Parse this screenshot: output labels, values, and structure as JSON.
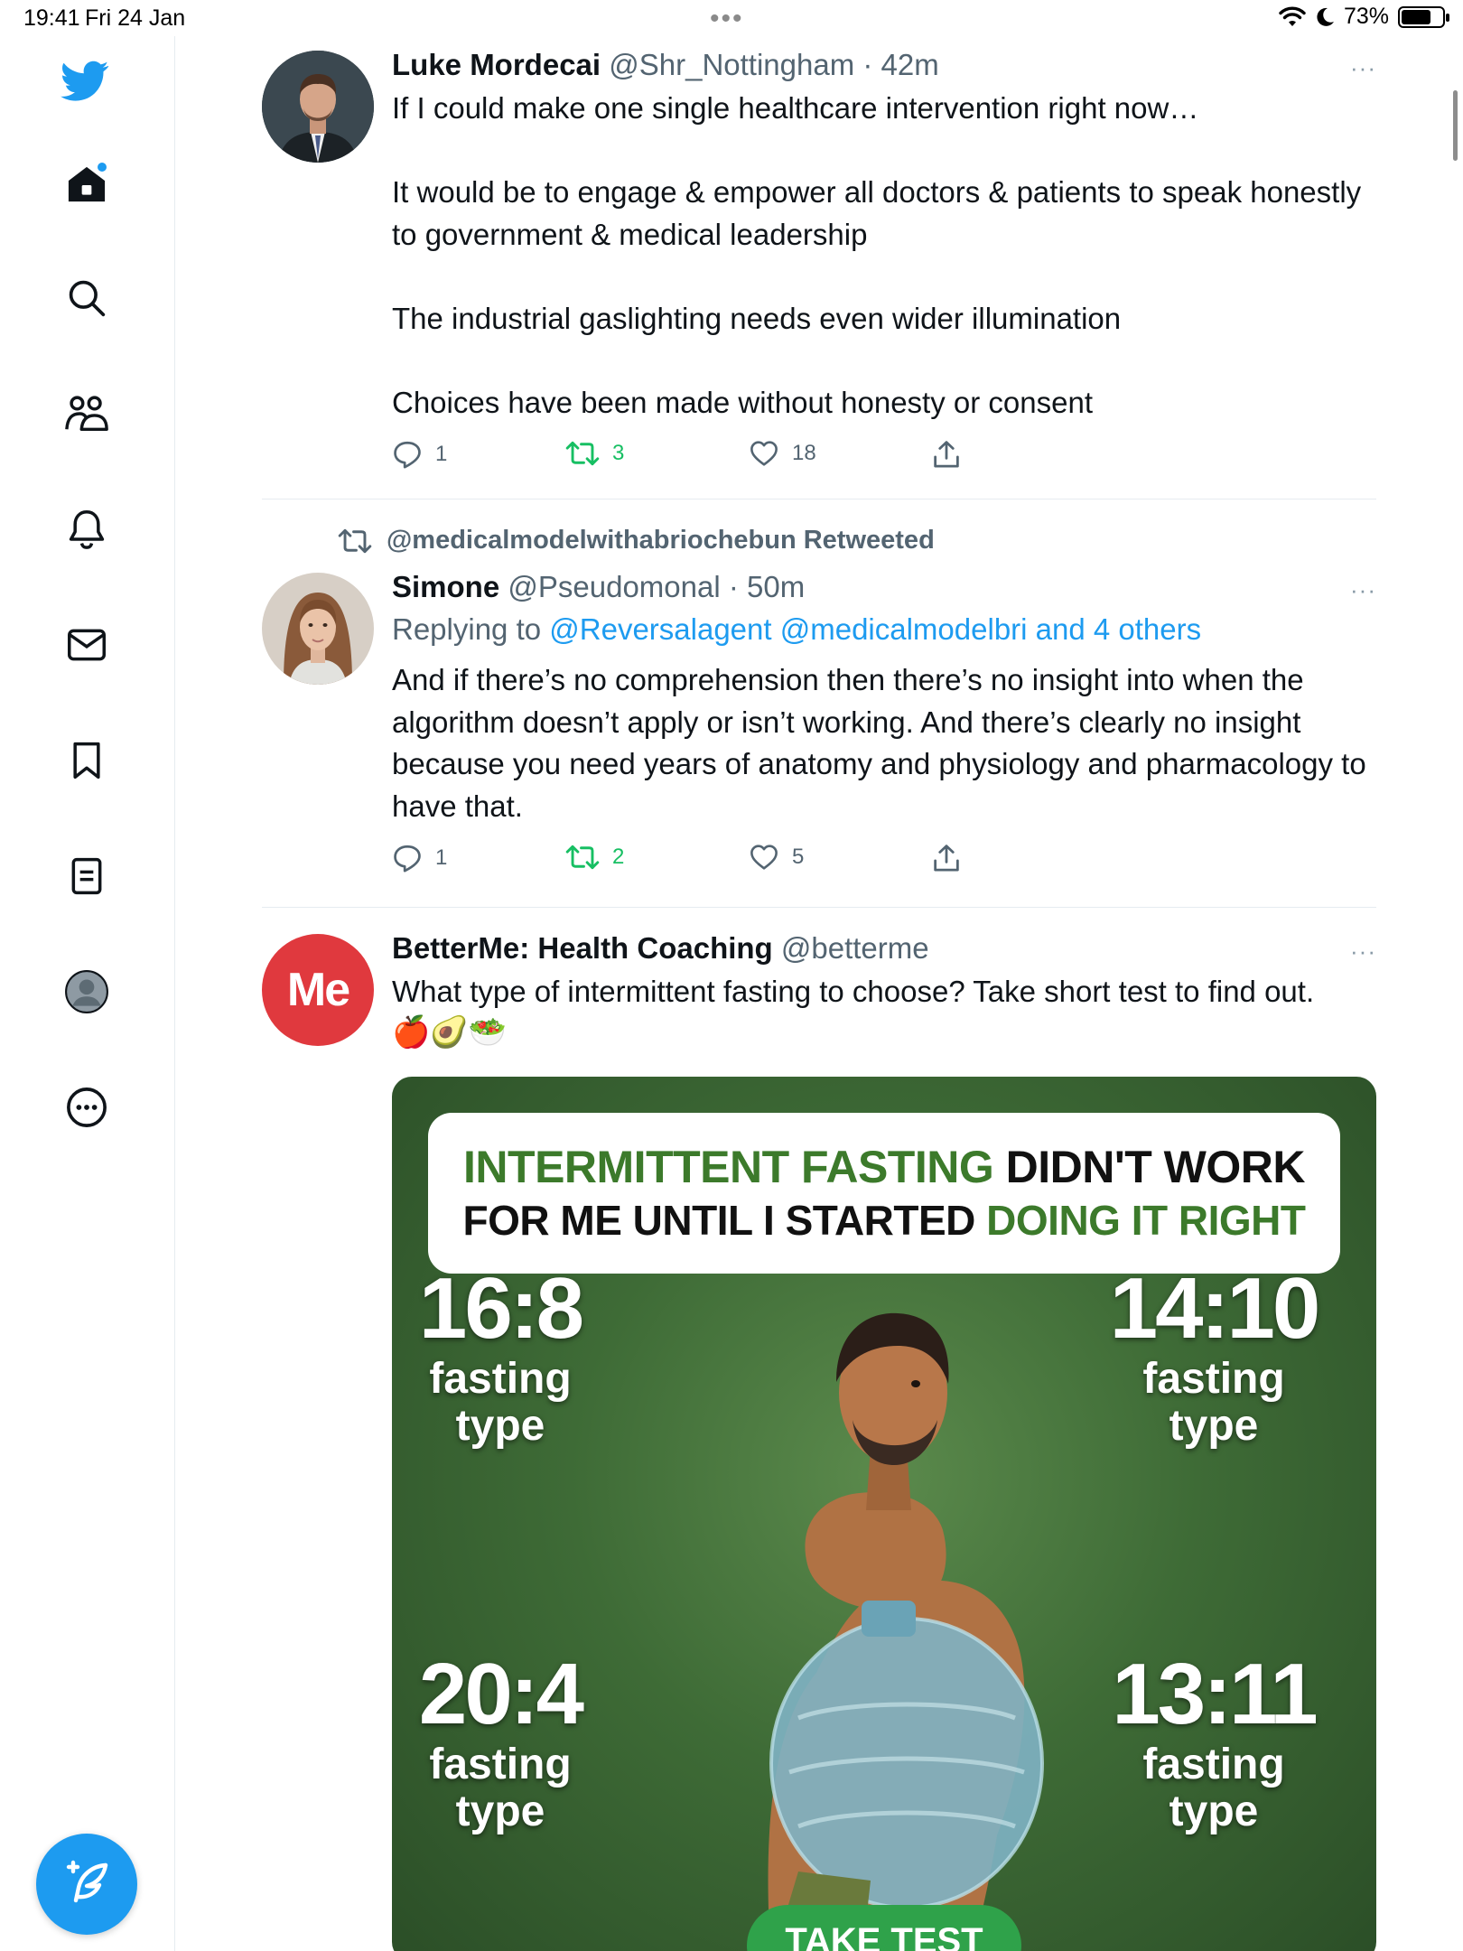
{
  "status_bar": {
    "time": "19:41",
    "date": "Fri 24 Jan",
    "dots": "•••",
    "battery_percent": "73%",
    "battery_level": 0.73
  },
  "sidebar": {
    "items": [
      {
        "name": "twitter-logo",
        "label": "Twitter"
      },
      {
        "name": "home",
        "label": "Home"
      },
      {
        "name": "search",
        "label": "Explore"
      },
      {
        "name": "communities",
        "label": "Communities"
      },
      {
        "name": "notifications",
        "label": "Notifications"
      },
      {
        "name": "messages",
        "label": "Messages"
      },
      {
        "name": "bookmarks",
        "label": "Bookmarks"
      },
      {
        "name": "lists",
        "label": "Lists"
      },
      {
        "name": "profile",
        "label": "Profile"
      },
      {
        "name": "more",
        "label": "More"
      }
    ],
    "compose_label": "Compose"
  },
  "tweets": [
    {
      "name": "Luke Mordecai",
      "handle": "@Shr_Nottingham",
      "time": " · 42m",
      "more": "···",
      "text": "If I could make one single healthcare intervention right now…\n\nIt would be to engage & empower all doctors & patients to speak honestly to government & medical leadership\n\nThe industrial gaslighting needs even wider illumination\n\nChoices have been made without honesty or consent",
      "replies": "1",
      "retweets": "3",
      "likes": "18"
    },
    {
      "retweeted_by": "@medicalmodelwithabriochebun Retweeted",
      "name": "Simone",
      "handle": "@Pseudomonal",
      "time": " · 50m",
      "more": "···",
      "replying_prefix": "Replying to ",
      "replying_to": "@Reversalagent @medicalmodelbri and 4 others",
      "text": "And if there’s no comprehension then there’s no insight into when the algorithm doesn’t apply or isn’t working. And there’s clearly no insight because you need years of anatomy and physiology and pharmacology to have that.",
      "replies": "1",
      "retweets": "2",
      "likes": "5"
    },
    {
      "avatar_text": "Me",
      "name": "BetterMe: Health Coaching",
      "handle": "@betterme",
      "more": "···",
      "text": "What type of intermittent fasting to choose? Take short test to find out.",
      "emojis": "🍎🥑🥗",
      "ad": {
        "line1_green": "INTERMITTENT FASTING",
        "line1_black": " DIDN'T WORK",
        "line2_black": "FOR ME UNTIL I STARTED ",
        "line2_green": "DOING IT RIGHT",
        "types": [
          {
            "ratio": "16:8",
            "label": "fasting type"
          },
          {
            "ratio": "14:10",
            "label": "fasting type"
          },
          {
            "ratio": "20:4",
            "label": "fasting type"
          },
          {
            "ratio": "13:11",
            "label": "fasting type"
          }
        ],
        "button": "TAKE TEST"
      }
    }
  ],
  "colors": {
    "twitter_blue": "#1d9bf0",
    "retweet_green": "#17bf63",
    "secondary_text": "#536471",
    "betterme_red": "#e0393e",
    "ad_green": "#3c7a2b"
  }
}
